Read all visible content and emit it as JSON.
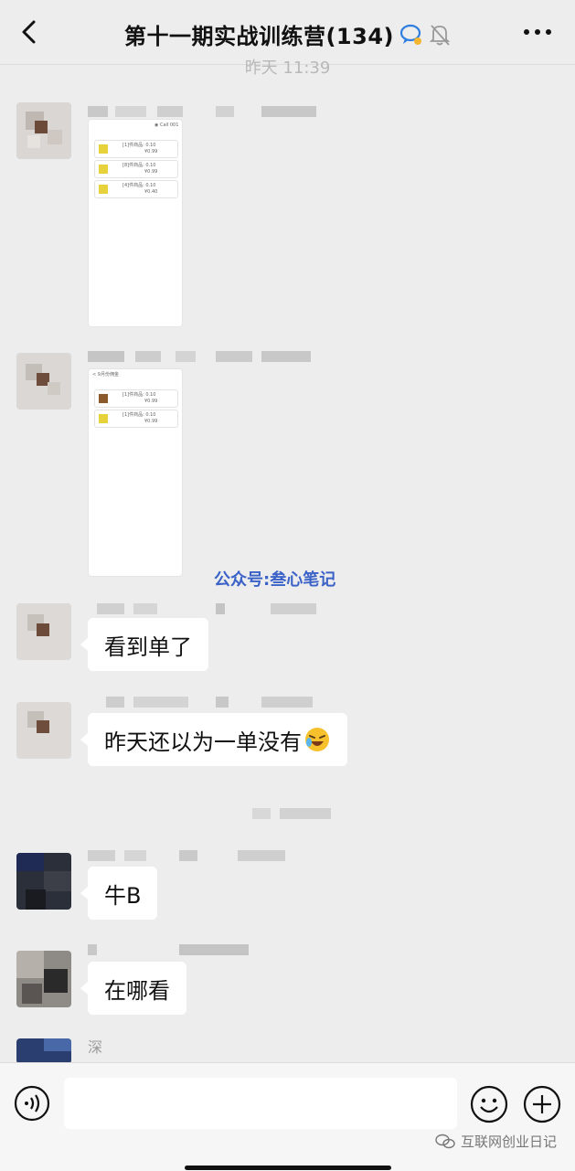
{
  "header": {
    "title": "第十一期实战训练营(134)",
    "back_icon": "chevron-left-icon",
    "chat_bubble_icon": "chat-bubble-icon",
    "mute_icon": "bell-off-icon",
    "more_icon": "more-dots-icon"
  },
  "timestamp": "昨天 11:39",
  "messages": [
    {
      "type": "image"
    },
    {
      "type": "image"
    },
    {
      "type": "text",
      "text": "看到单了"
    },
    {
      "type": "text",
      "text": "昨天还以为一单没有"
    },
    {
      "type": "text",
      "text": "牛B"
    },
    {
      "type": "text",
      "text": "在哪看"
    },
    {
      "type": "partial",
      "sender_fragment": "深"
    }
  ],
  "screenshot_thumbs": {
    "first": [
      {
        "line1": "[1]件商品: 0.10",
        "line2": "¥0.99"
      },
      {
        "line1": "[8]件商品: 0.10",
        "line2": "¥0.99"
      },
      {
        "line1": "[4]件商品: 0.10",
        "line2": "¥0.40"
      }
    ],
    "second": [
      {
        "line1": "[1]件商品: 0.10",
        "line2": "¥0.99"
      },
      {
        "line1": "[1]件商品: 0.10",
        "line2": "¥0.99"
      }
    ],
    "first_status": "◉ Call 001",
    "second_title": "< 9月份佣金"
  },
  "watermark_mid": "公众号:叁心笔记",
  "watermark_bottom": "互联网创业日记",
  "input": {
    "placeholder": "",
    "value": ""
  },
  "colors": {
    "background": "#ededed",
    "bubble": "#ffffff",
    "watermark": "#3a62c7"
  }
}
